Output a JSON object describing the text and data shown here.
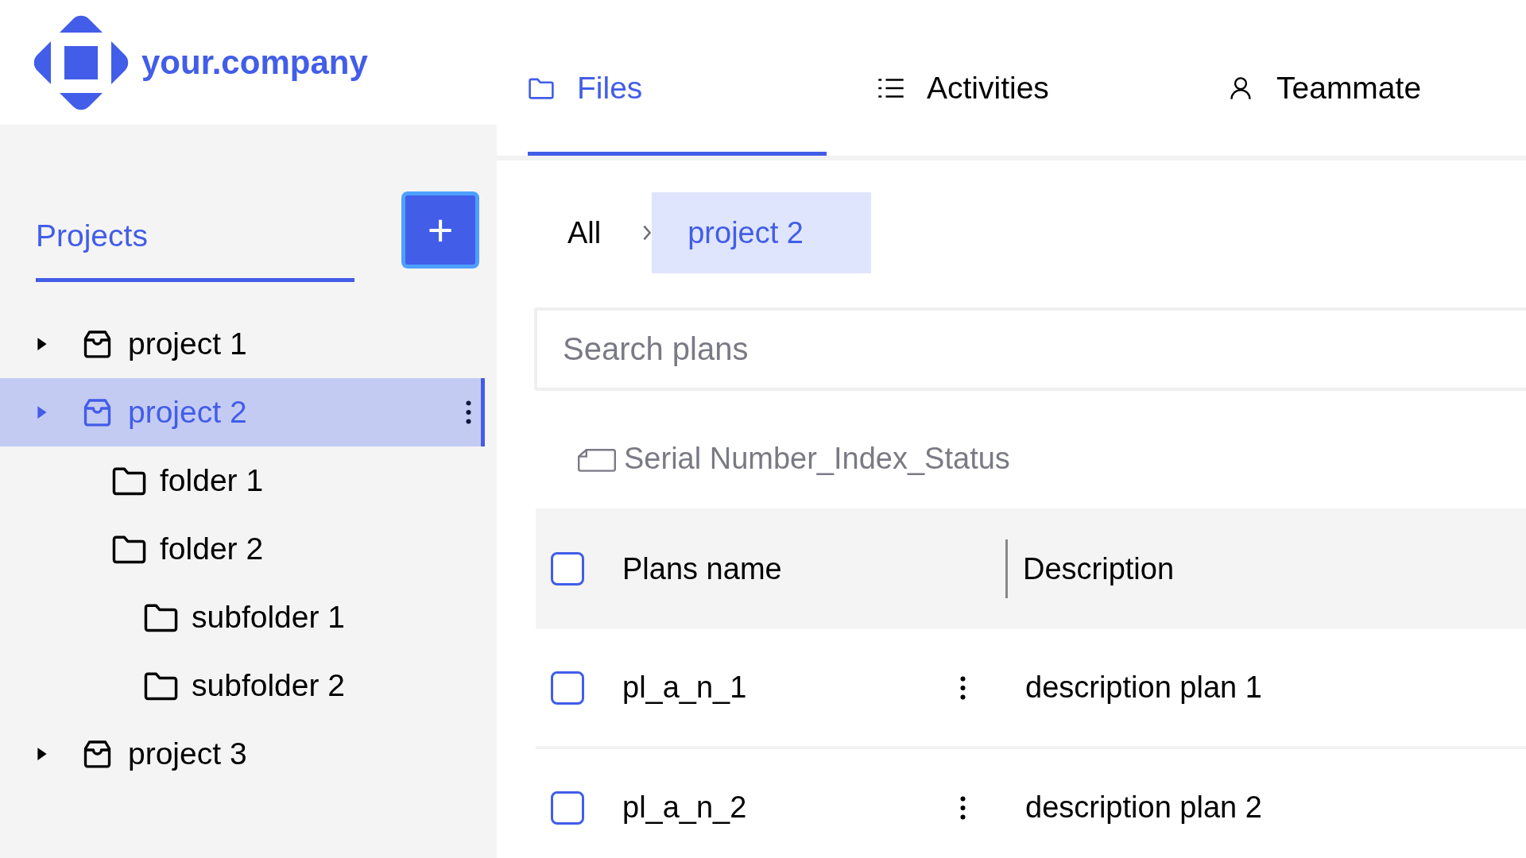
{
  "logo": {
    "text": "your.company"
  },
  "tabs": [
    {
      "label": "Files",
      "selected": true
    },
    {
      "label": "Activities",
      "selected": false
    },
    {
      "label": "Teammate",
      "selected": false
    }
  ],
  "sidebar": {
    "title": "Projects",
    "add_button": "+",
    "tree": [
      {
        "label": "project 1",
        "kind": "project",
        "selected": false
      },
      {
        "label": "project 2",
        "kind": "project",
        "selected": true,
        "children": [
          {
            "label": "folder 1",
            "kind": "folder",
            "selected": false
          },
          {
            "label": "folder 2",
            "kind": "folder",
            "selected": false,
            "children": [
              {
                "label": "subfolder 1",
                "kind": "folder",
                "selected": false
              },
              {
                "label": "subfolder 2",
                "kind": "folder",
                "selected": false
              }
            ]
          }
        ]
      },
      {
        "label": "project 3",
        "kind": "project",
        "selected": false
      }
    ]
  },
  "breadcrumb": [
    {
      "label": "All",
      "selected": false
    },
    {
      "label": "project 2",
      "selected": true
    }
  ],
  "search": {
    "placeholder": "Search plans"
  },
  "group_label": "Serial Number_Index_Status",
  "table": {
    "header_checked": false,
    "columns": [
      "Plans name",
      "Description"
    ],
    "rows": [
      {
        "name": "pl_a_n_1",
        "description": "description plan 1",
        "checked": false
      },
      {
        "name": "pl_a_n_2",
        "description": "description plan 2",
        "checked": false
      }
    ]
  }
}
